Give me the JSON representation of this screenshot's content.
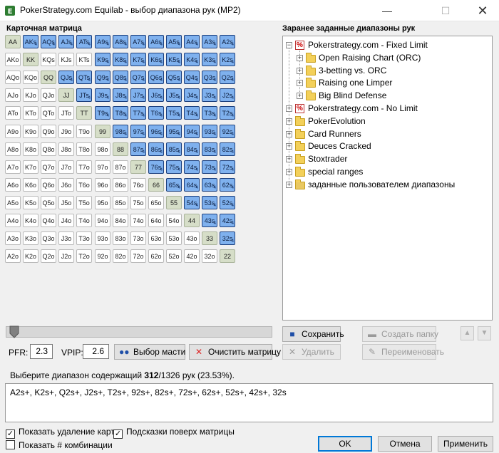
{
  "window": {
    "title": "PokerStrategy.com Equilab - выбор диапазона рук (MP2)",
    "minimize": "—",
    "maximize": "☐",
    "close": "✕"
  },
  "matrix": {
    "label": "Карточная матрица",
    "ranks": [
      "A",
      "K",
      "Q",
      "J",
      "T",
      "9",
      "8",
      "7",
      "6",
      "5",
      "4",
      "3",
      "2"
    ],
    "suit_marker": "4",
    "selected_suited": [
      "AKs",
      "AQs",
      "AJs",
      "ATs",
      "A9s",
      "A8s",
      "A7s",
      "A6s",
      "A5s",
      "A4s",
      "A3s",
      "A2s",
      "K9s",
      "K8s",
      "K7s",
      "K6s",
      "K5s",
      "K4s",
      "K3s",
      "K2s",
      "QJs",
      "QTs",
      "Q9s",
      "Q8s",
      "Q7s",
      "Q6s",
      "Q5s",
      "Q4s",
      "Q3s",
      "Q2s",
      "JTs",
      "J9s",
      "J8s",
      "J7s",
      "J6s",
      "J5s",
      "J4s",
      "J3s",
      "J2s",
      "T9s",
      "T8s",
      "T7s",
      "T6s",
      "T5s",
      "T4s",
      "T3s",
      "T2s",
      "98s",
      "97s",
      "96s",
      "95s",
      "94s",
      "93s",
      "92s",
      "87s",
      "86s",
      "85s",
      "84s",
      "83s",
      "82s",
      "76s",
      "75s",
      "74s",
      "73s",
      "72s",
      "65s",
      "64s",
      "63s",
      "62s",
      "54s",
      "53s",
      "52s",
      "43s",
      "42s",
      "32s"
    ]
  },
  "ranges": {
    "label": "Заранее заданные диапазоны рук",
    "tree": [
      {
        "label": "Pokerstrategy.com - Fixed Limit",
        "icon": "ps-icon",
        "mark": "%",
        "expander": "−",
        "level": 0
      },
      {
        "label": "Open Raising Chart (ORC)",
        "icon": "folder-icon",
        "expander": "+",
        "level": 1
      },
      {
        "label": "3-betting vs. ORC",
        "icon": "folder-icon",
        "expander": "+",
        "level": 1
      },
      {
        "label": "Raising one Limper",
        "icon": "folder-icon",
        "expander": "+",
        "level": 1
      },
      {
        "label": "Big Blind Defense",
        "icon": "folder-icon",
        "expander": "+",
        "level": 1
      },
      {
        "label": "Pokerstrategy.com - No Limit",
        "icon": "ps-icon",
        "mark": "%",
        "expander": "+",
        "level": 0
      },
      {
        "label": "PokerEvolution",
        "icon": "folder-icon",
        "expander": "+",
        "level": 0
      },
      {
        "label": "Card Runners",
        "icon": "folder-icon",
        "expander": "+",
        "level": 0
      },
      {
        "label": "Deuces Cracked",
        "icon": "folder-icon",
        "expander": "+",
        "level": 0
      },
      {
        "label": "Stoxtrader",
        "icon": "folder-icon",
        "expander": "+",
        "level": 0
      },
      {
        "label": "special ranges",
        "icon": "folder-icon",
        "expander": "+",
        "level": 0
      },
      {
        "label": "заданные пользователем диапазоны",
        "icon": "user-folder-icon",
        "expander": "+",
        "level": 0
      }
    ],
    "buttons": {
      "save": "Сохранить",
      "create_folder": "Создать папку",
      "delete": "Удалить",
      "rename": "Переименовать",
      "up_arrow": "▲",
      "down_arrow": "▼"
    }
  },
  "controls": {
    "pfr_label": "PFR:",
    "pfr_value": "2.3",
    "vpip_label": "VPIP:",
    "vpip_value": "2.6",
    "suit_button": "Выбор масти",
    "clear_button": "Очистить матрицу"
  },
  "summary": {
    "prefix": "Выберите диапазон содержащий ",
    "selected": "312",
    "suffix": "/1326 рук (23.53%)."
  },
  "range_text": "A2s+, K2s+, Q2s+, J2s+, T2s+, 92s+, 82s+, 72s+, 62s+, 52s+, 42s+, 32s",
  "options": {
    "show_card_removal": {
      "label": "Показать удаление карт",
      "checked": true
    },
    "matrix_hints": {
      "label": "Подсказки поверх матрицы",
      "checked": true
    },
    "show_combos": {
      "label": "Показать # комбинации",
      "checked": false
    }
  },
  "footer": {
    "ok": "OK",
    "cancel": "Отмена",
    "apply": "Применить"
  },
  "colors": {
    "selected_cell": "#7fb1ee",
    "pair_cell": "#d6dec8",
    "unselected_cell": "#ffffff"
  }
}
